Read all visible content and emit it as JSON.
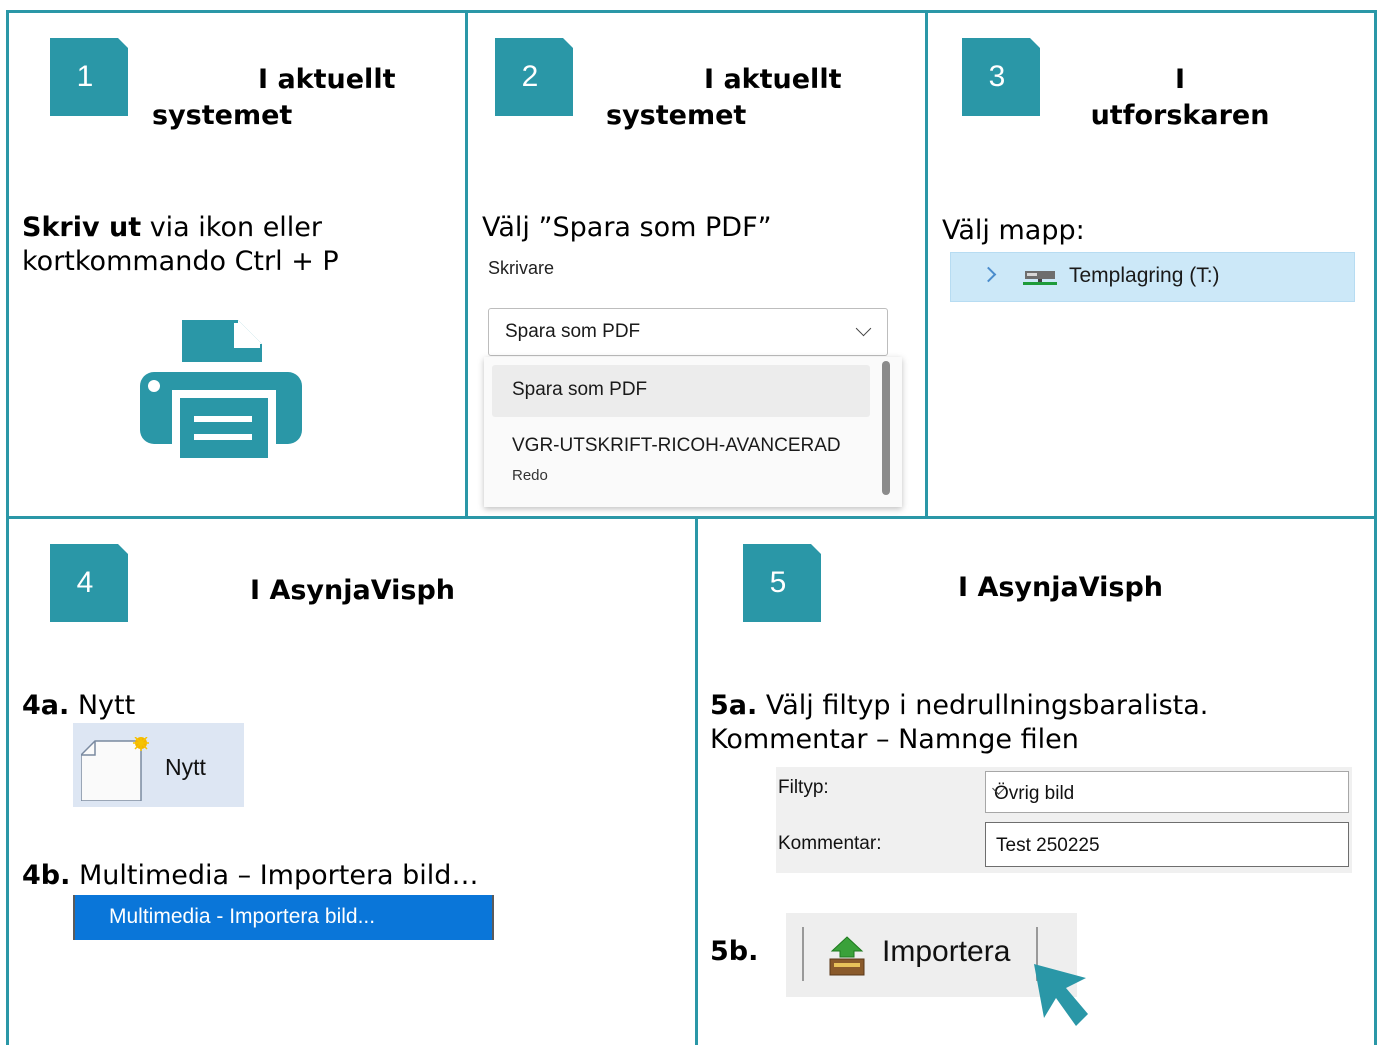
{
  "steps": [
    {
      "num": "1",
      "heading_line1": "I aktuellt",
      "heading_line2": "systemet"
    },
    {
      "num": "2",
      "heading_line1": "I aktuellt",
      "heading_line2": "systemet"
    },
    {
      "num": "3",
      "heading_line1": "I",
      "heading_line2": "utforskaren"
    },
    {
      "num": "4",
      "heading": "I AsynjaVisph"
    },
    {
      "num": "5",
      "heading": "I AsynjaVisph"
    }
  ],
  "step1": {
    "bold": "Skriv ut",
    "rest": " via ikon eller",
    "line2": "kortkommando Ctrl + P",
    "icon": "printer-icon"
  },
  "step2": {
    "instruction": "Välj ”Spara som PDF”",
    "printer_label": "Skrivare",
    "selected": "Spara som PDF",
    "options": [
      {
        "name": "Spara som PDF"
      },
      {
        "name": "VGR-UTSKRIFT-RICOH-AVANCERAD",
        "status": "Redo"
      }
    ]
  },
  "step3": {
    "instruction": "Välj mapp:",
    "folder": "Templagring (T:)"
  },
  "step4": {
    "a_label": "4a.",
    "a_text": " Nytt",
    "nytt_button": "Nytt",
    "b_label": "4b.",
    "b_text": " Multimedia – Importera bild…",
    "menu_item": "Multimedia - Importera bild..."
  },
  "step5": {
    "a_label": "5a.",
    "a_text": " Välj filtyp i nedrullningsbaralista.",
    "a_line2": "Kommentar – Namnge filen",
    "filtyp_label": "Filtyp:",
    "filtyp_value": "Övrig bild",
    "kommentar_label": "Kommentar:",
    "kommentar_value": "Test 250225",
    "b_label": "5b.",
    "import_button": "Importera"
  },
  "colors": {
    "accent": "#2a97a7",
    "menu_highlight": "#0a76d9"
  }
}
